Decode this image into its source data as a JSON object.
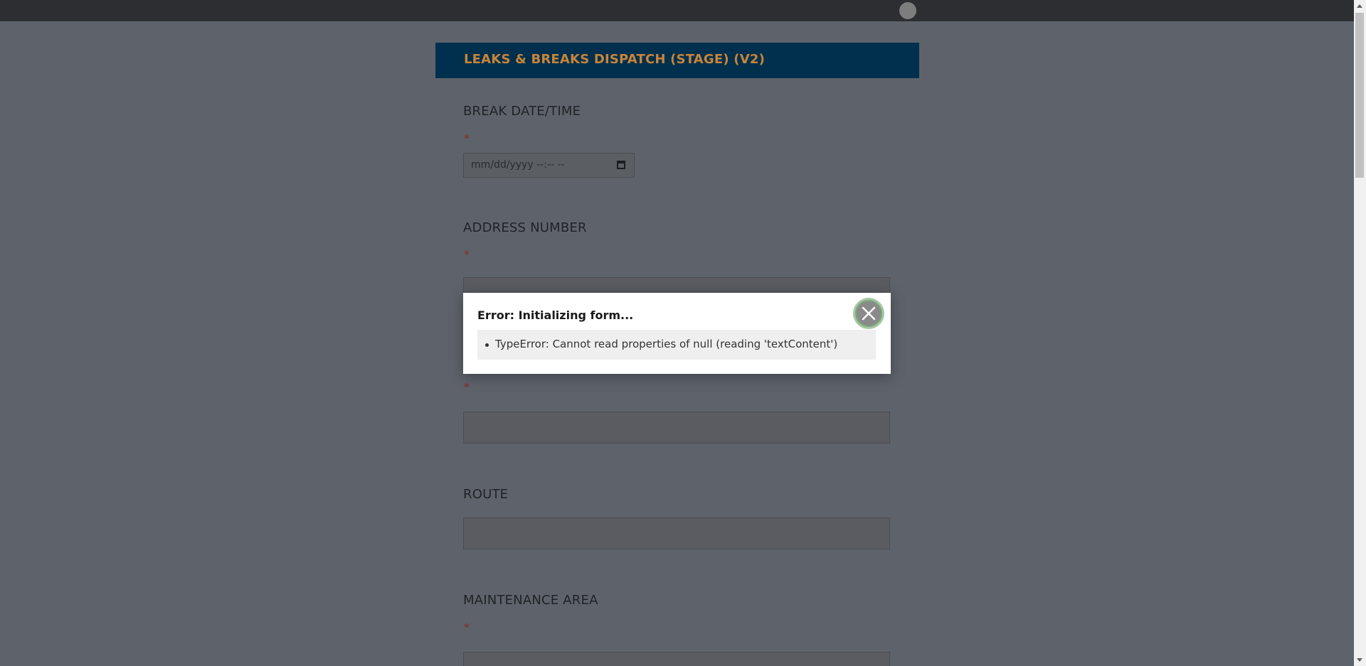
{
  "header": {
    "title": "LEAKS & BREAKS DISPATCH (STAGE) (V2)"
  },
  "fields": [
    {
      "label": "BREAK DATE/TIME",
      "required": "*",
      "placeholder": "mm/dd/yyyy --:-- --"
    },
    {
      "label": "ADDRESS NUMBER",
      "required": "*"
    },
    {
      "label": "",
      "required": "*"
    },
    {
      "label": "ROUTE"
    },
    {
      "label": "MAINTENANCE AREA",
      "required": "*"
    }
  ],
  "modal": {
    "title": "Error: Initializing form...",
    "errors": [
      "TypeError: Cannot read properties of null (reading 'textContent')"
    ]
  },
  "icons": {
    "close": "close-icon",
    "calendar": "calendar-icon",
    "avatar": "avatar"
  },
  "colors": {
    "header_bg": "#00304d",
    "header_text": "#c8843b",
    "overlay": "#5e636b"
  }
}
